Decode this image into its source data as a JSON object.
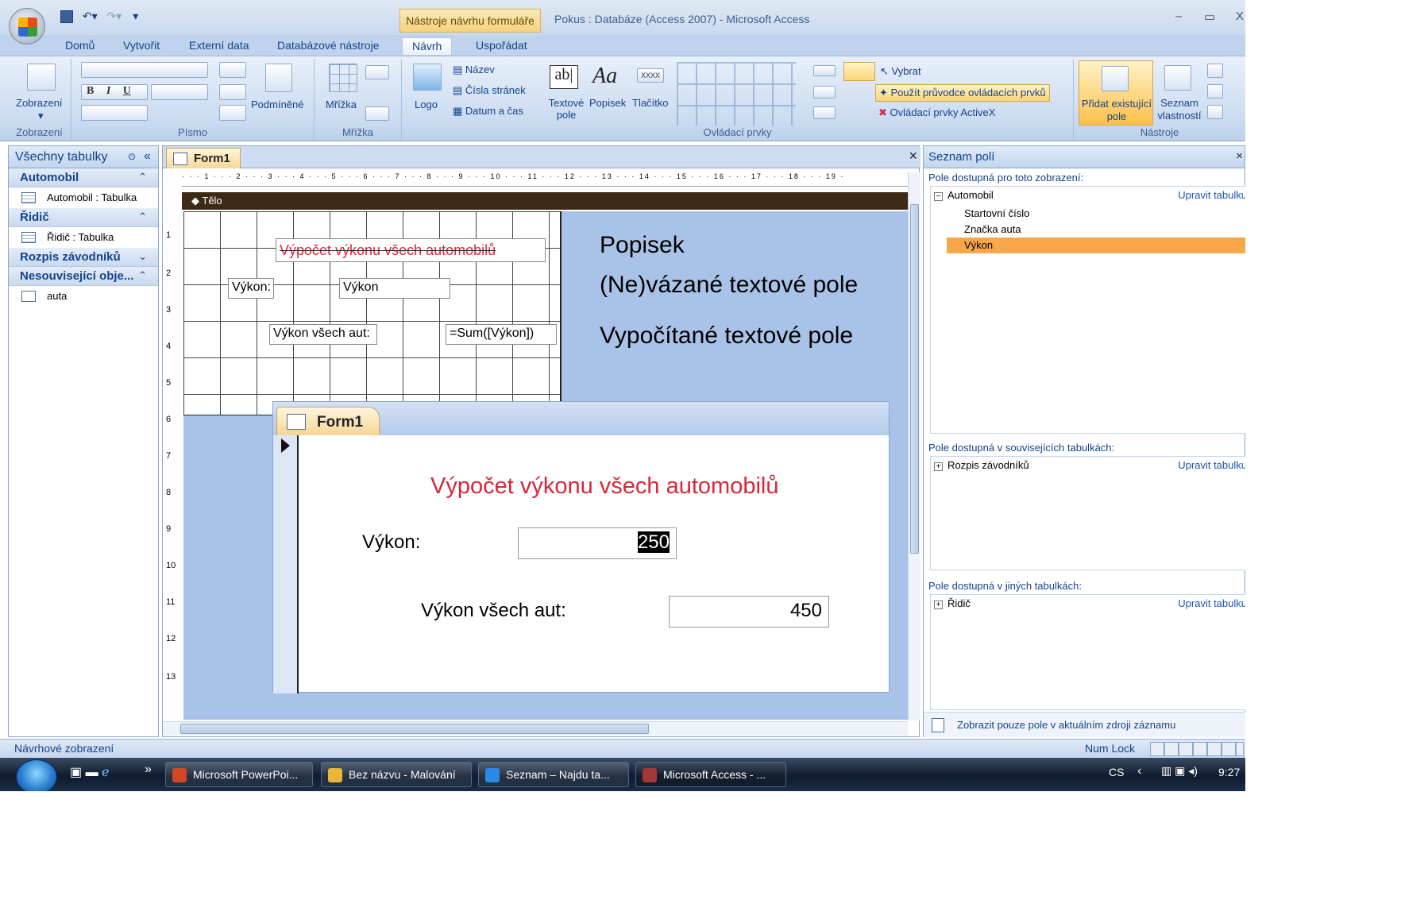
{
  "window": {
    "contextual_tab_group": "Nástroje návrhu formuláře",
    "title": "Pokus : Databáze (Access 2007) - Microsoft Access",
    "minimize": "–",
    "restore": "▭",
    "close": "X"
  },
  "tabs": [
    "Domů",
    "Vytvořit",
    "Externí data",
    "Databázové nástroje",
    "Návrh",
    "Uspořádat"
  ],
  "active_tab": "Návrh",
  "ribbon": {
    "zobrazeni": {
      "button": "Zobrazení",
      "group": "Zobrazení"
    },
    "pismo": {
      "bold": "B",
      "italic": "I",
      "underline": "U",
      "conditional": "Podmíněné",
      "group": "Písmo"
    },
    "mrizka": {
      "button": "Mřížka",
      "group": "Mřížka"
    },
    "controls": {
      "logo": "Logo",
      "nazev": "Název",
      "cisla_stranek": "Čísla stránek",
      "datum_a_cas": "Datum a čas",
      "textove_pole": "Textové pole",
      "textbox_glyph": "ab|",
      "popisek": "Popisek",
      "popisek_glyph": "Aa",
      "tlacitko": "Tlačítko",
      "tlacitko_glyph": "XXXX",
      "vybrat": "Vybrat",
      "pouzit_pruvodce": "Použít průvodce ovládacích prvků",
      "activex": "Ovládací prvky ActiveX",
      "group": "Ovládací prvky"
    },
    "nastroje": {
      "pridat": "Přidat existující pole",
      "seznam": "Seznam vlastností",
      "group": "Nástroje"
    }
  },
  "nav": {
    "header": "Všechny tabulky",
    "sections": [
      {
        "label": "Automobil",
        "chevron": "⌃",
        "items": [
          "Automobil : Tabulka"
        ]
      },
      {
        "label": "Řidič",
        "chevron": "⌃",
        "items": [
          "Řidič : Tabulka"
        ]
      },
      {
        "label": "Rozpis závodníků",
        "chevron": "⌄",
        "items": []
      },
      {
        "label": "Nesouvisející obje...",
        "chevron": "⌃",
        "items": [
          "auta"
        ]
      }
    ]
  },
  "doc": {
    "tab": "Form1",
    "close": "×",
    "section": "Tělo",
    "ruler": "· · · 1 · · · 2 · · · 3 · · · 4 · · · 5 · · · 6 · · · 7 · · · 8 · · · 9 · · · 10 · · · 11 · · · 12 · · · 13 · · · 14 · · · 15 · · · 16 · · · 17 · · · 18 · · · 19 ·",
    "vruler": [
      "1",
      "2",
      "3",
      "4",
      "5",
      "6",
      "7",
      "8",
      "9",
      "10",
      "11",
      "12",
      "13"
    ],
    "design": {
      "title": "Výpočet výkonu všech automobilů",
      "label_vykon": "Výkon:",
      "field_vykon": "Výkon",
      "label_vsech": "Výkon všech aut:",
      "field_sum": "=Sum([Výkon])"
    },
    "annotations": [
      "Popisek",
      "(Ne)vázané textové pole",
      "Vypočítané textové pole"
    ]
  },
  "popup": {
    "tab": "Form1",
    "title": "Výpočet výkonu všech automobilů",
    "label_vykon": "Výkon:",
    "value_vykon": "250",
    "label_vsech": "Výkon všech aut:",
    "value_vsech": "450"
  },
  "field_list": {
    "header": "Seznam polí",
    "close": "×",
    "available": "Pole dostupná pro toto zobrazení:",
    "table1": "Automobil",
    "edit": "Upravit tabulku",
    "fields": [
      "Startovní číslo",
      "Značka auta",
      "Výkon"
    ],
    "related": "Pole dostupná v souvisejících tabulkách:",
    "table2": "Rozpis závodníků",
    "other": "Pole dostupná v jiných tabulkách:",
    "table3": "Řidič",
    "bottom": "Zobrazit pouze pole v aktuálním zdroji záznamu"
  },
  "status": {
    "left": "Návrhové zobrazení",
    "numlock": "Num Lock"
  },
  "taskbar": {
    "items": [
      "Microsoft PowerPoi...",
      "Bez názvu - Malování",
      "Seznam – Najdu ta...",
      "Microsoft Access - ..."
    ],
    "chevron": "»",
    "lang": "CS",
    "arrow": "‹",
    "time": "9:27"
  },
  "colors": {
    "accent_red": "#d9263a",
    "selected_field": "#f7a64a",
    "ribbon_blue": "#c9daf0"
  }
}
